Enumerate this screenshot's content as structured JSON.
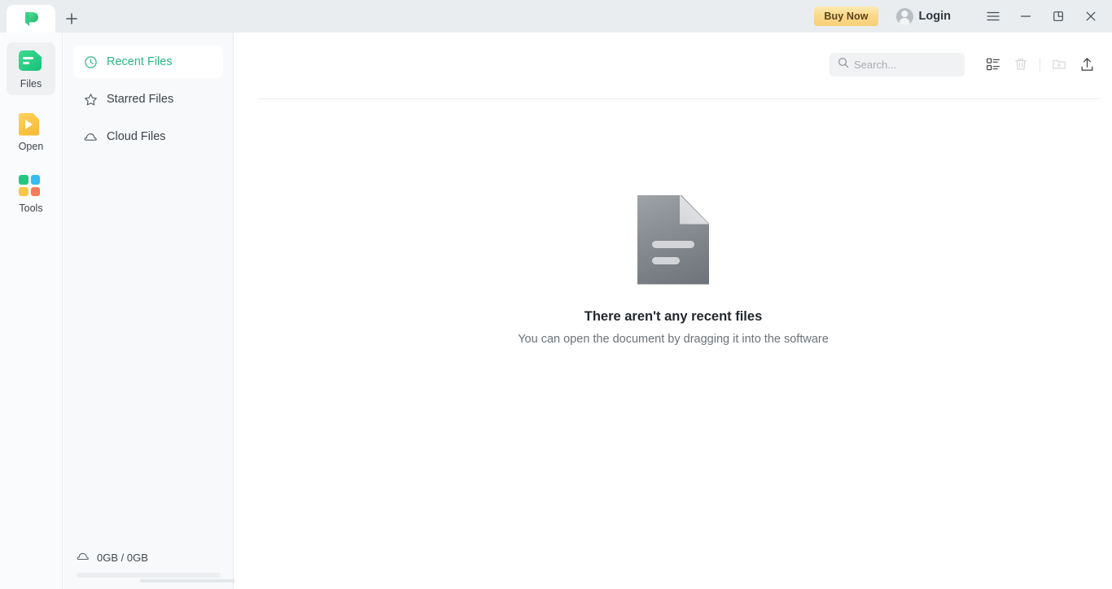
{
  "app": {
    "logo_icon": "green-p-leaf-logo",
    "brand_color": "#22c07d"
  },
  "titlebar": {
    "new_tab_icon": "plus-icon",
    "buy_now_label": "Buy Now",
    "buy_now_color": "#f7cf78",
    "login_label": "Login",
    "avatar_icon": "user-avatar-icon",
    "menu_icon": "hamburger-menu-icon",
    "minimize_icon": "minimize-icon",
    "restore_icon": "restore-window-icon",
    "close_icon": "close-icon"
  },
  "rail": {
    "items": [
      {
        "label": "Files",
        "icon": "files-icon",
        "active": true
      },
      {
        "label": "Open",
        "icon": "open-file-icon",
        "active": false
      },
      {
        "label": "Tools",
        "icon": "tools-grid-icon",
        "active": false
      }
    ]
  },
  "nav": {
    "items": [
      {
        "label": "Recent Files",
        "icon": "clock-icon",
        "active": true
      },
      {
        "label": "Starred Files",
        "icon": "star-icon",
        "active": false
      },
      {
        "label": "Cloud Files",
        "icon": "cloud-icon",
        "active": false
      }
    ]
  },
  "storage": {
    "icon": "cloud-icon",
    "label": "0GB / 0GB",
    "used_gb": 0,
    "total_gb": 0,
    "percent": 0
  },
  "toolbar": {
    "search_placeholder": "Search...",
    "search_value": "",
    "search_icon": "search-icon",
    "list_view_icon": "list-view-icon",
    "delete_icon": "trash-icon",
    "new_folder_icon": "new-folder-icon",
    "upload_icon": "upload-icon"
  },
  "empty_state": {
    "icon": "document-placeholder-icon",
    "title": "There aren't any recent files",
    "subtitle": "You can open the document by dragging it into the software"
  }
}
